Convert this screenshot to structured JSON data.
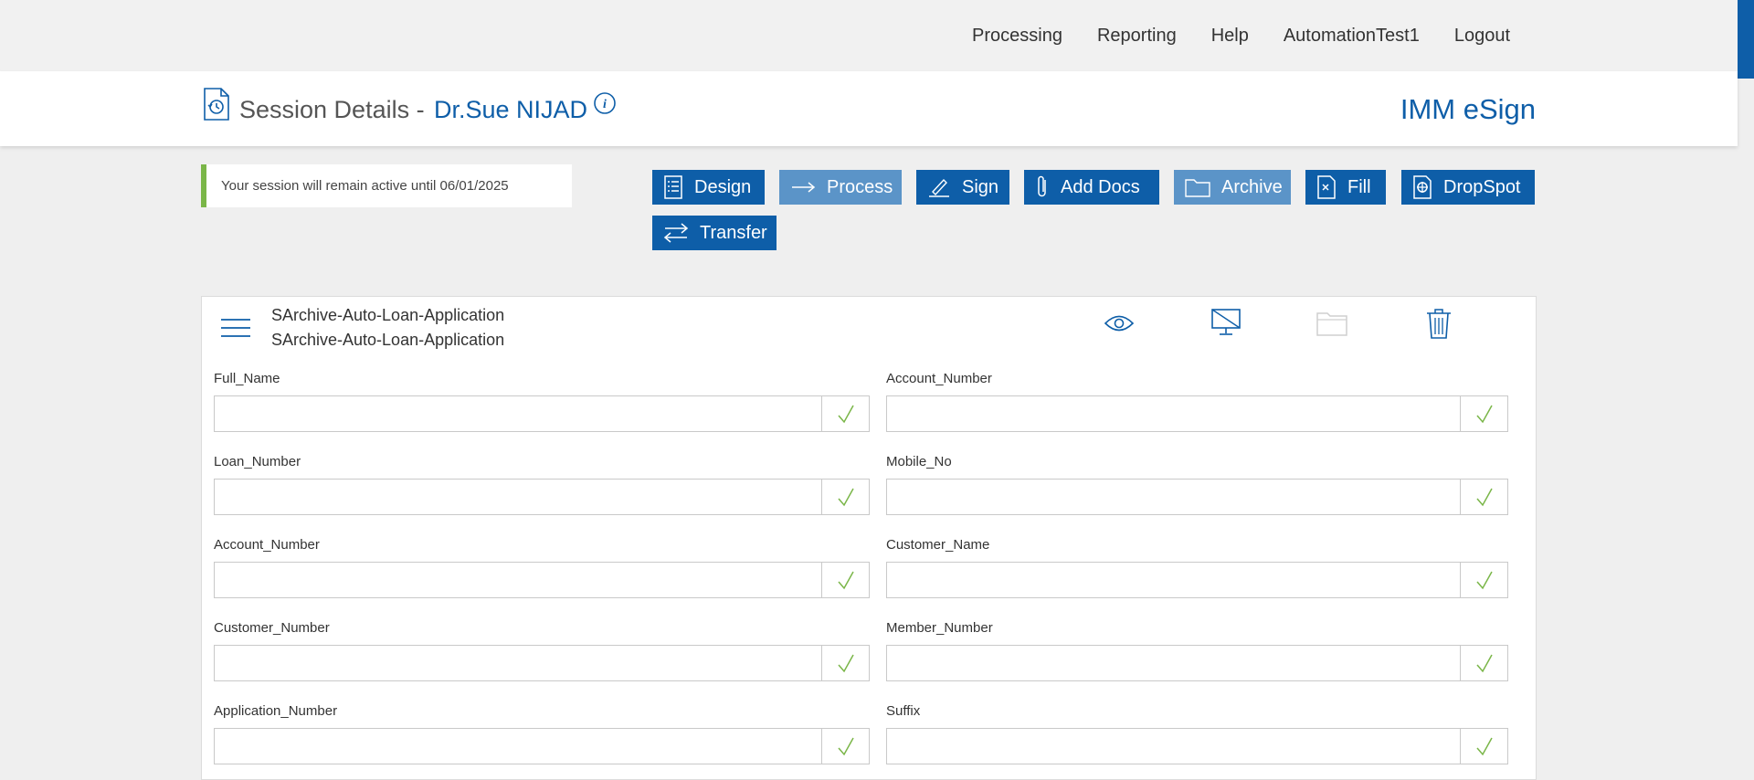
{
  "nav": {
    "items": [
      "Processing",
      "Reporting",
      "Help",
      "AutomationTest1",
      "Logout"
    ]
  },
  "header": {
    "title": "Session Details -",
    "person": "Dr.Sue NIJAD",
    "brand": "IMM eSign"
  },
  "notice": {
    "text": "Your session will remain active until 06/01/2025"
  },
  "actions": {
    "design": "Design",
    "process": "Process",
    "sign": "Sign",
    "add_docs": "Add Docs",
    "archive": "Archive",
    "fill": "Fill",
    "dropspot": "DropSpot",
    "transfer": "Transfer"
  },
  "document": {
    "name_line1": "SArchive-Auto-Loan-Application",
    "name_line2": "SArchive-Auto-Loan-Application"
  },
  "fields": {
    "left": [
      {
        "label": "Full_Name",
        "value": ""
      },
      {
        "label": "Loan_Number",
        "value": ""
      },
      {
        "label": "Account_Number",
        "value": ""
      },
      {
        "label": "Customer_Number",
        "value": ""
      },
      {
        "label": "Application_Number",
        "value": ""
      }
    ],
    "right": [
      {
        "label": "Account_Number",
        "value": ""
      },
      {
        "label": "Mobile_No",
        "value": ""
      },
      {
        "label": "Customer_Name",
        "value": ""
      },
      {
        "label": "Member_Number",
        "value": ""
      },
      {
        "label": "Suffix",
        "value": ""
      }
    ]
  },
  "colors": {
    "primary": "#0e5ea8",
    "primary_disabled": "#5b94c8",
    "notice_accent": "#7ab648",
    "check": "#7ab648"
  },
  "icons": {
    "title": "session-history-icon",
    "info": "info-icon",
    "menu": "hamburger-icon",
    "view": "eye-icon",
    "display": "monitor-off-icon",
    "folder": "folder-icon",
    "delete": "trash-icon",
    "valid": "check-icon"
  }
}
